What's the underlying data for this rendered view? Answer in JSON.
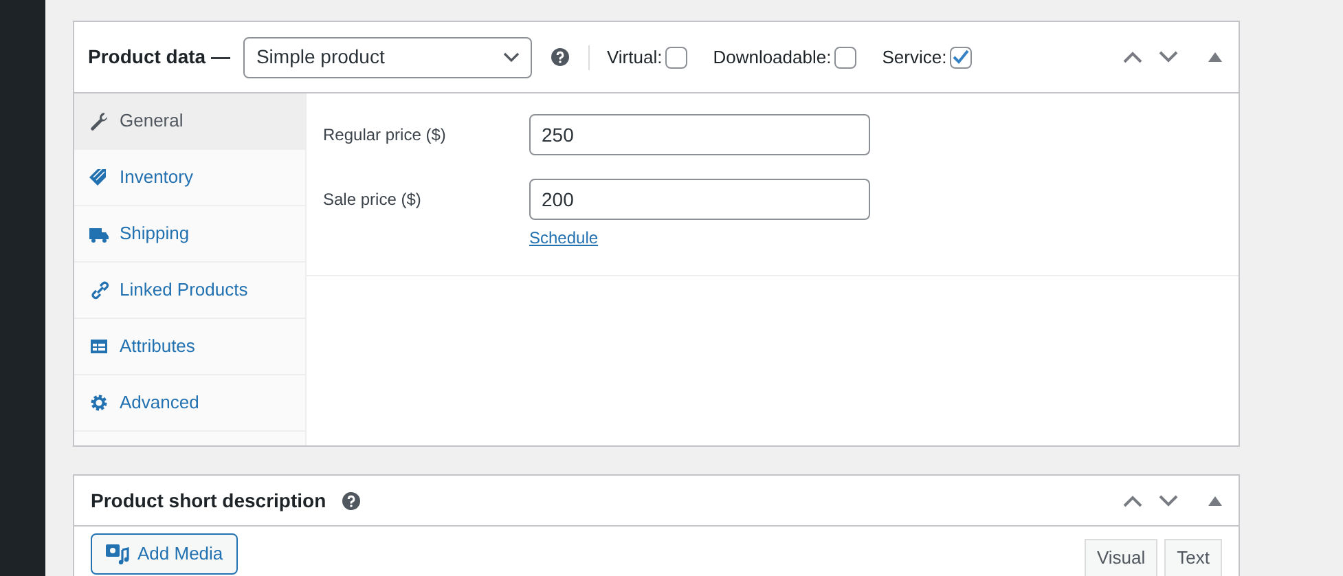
{
  "product_data": {
    "title": "Product data —",
    "product_type": "Simple product",
    "options": [
      {
        "label": "Virtual:",
        "checked": false
      },
      {
        "label": "Downloadable:",
        "checked": false
      },
      {
        "label": "Service:",
        "checked": true
      }
    ],
    "tabs": [
      {
        "label": "General",
        "selected": true
      },
      {
        "label": "Inventory",
        "selected": false
      },
      {
        "label": "Shipping",
        "selected": false
      },
      {
        "label": "Linked Products",
        "selected": false
      },
      {
        "label": "Attributes",
        "selected": false
      },
      {
        "label": "Advanced",
        "selected": false
      }
    ],
    "fields": [
      {
        "label": "Regular price ($)",
        "value": "250"
      },
      {
        "label": "Sale price ($)",
        "value": "200",
        "link": "Schedule"
      }
    ]
  },
  "short_description": {
    "title": "Product short description",
    "add_media": "Add Media",
    "editor_tabs": [
      "Visual",
      "Text"
    ]
  }
}
